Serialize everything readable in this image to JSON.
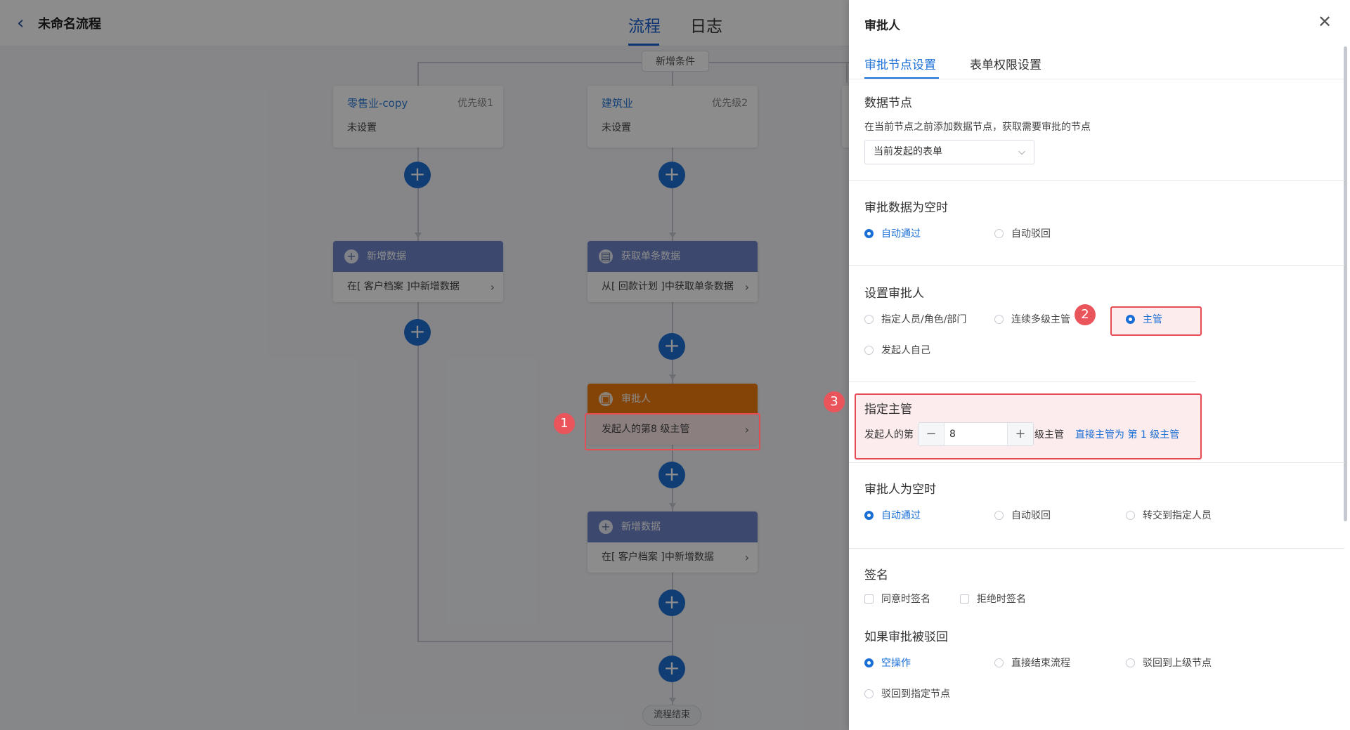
{
  "header": {
    "back_icon": "chevron-left-icon",
    "title": "未命名流程",
    "tabs": [
      "流程",
      "日志"
    ],
    "active_tab": "流程"
  },
  "flow": {
    "add_condition": "新增条件",
    "conditions": [
      {
        "name": "零售业-copy",
        "priority": "优先级1",
        "status": "未设置"
      },
      {
        "name": "建筑业",
        "priority": "优先级2",
        "status": "未设置"
      }
    ],
    "nodes": {
      "left_add": {
        "title": "新增数据",
        "body": "在[ 客户档案 ]中新增数据"
      },
      "mid_fetch": {
        "title": "获取单条数据",
        "body": "从[ 回款计划 ]中获取单条数据"
      },
      "approver": {
        "title": "审批人",
        "body": "发起人的第8 级主管"
      },
      "mid_add": {
        "title": "新增数据",
        "body": "在[ 客户档案 ]中新增数据"
      }
    },
    "end_label": "流程结束",
    "plus_symbol": "+"
  },
  "annotations": [
    "1",
    "2",
    "3"
  ],
  "drawer": {
    "title": "审批人",
    "close_icon": "close-icon",
    "tabs": [
      "审批节点设置",
      "表单权限设置"
    ],
    "active_tab": "审批节点设置",
    "data_node": {
      "title": "数据节点",
      "desc": "在当前节点之前添加数据节点，获取需要审批的节点",
      "select_value": "当前发起的表单"
    },
    "empty_data": {
      "title": "审批数据为空时",
      "options": [
        "自动通过",
        "自动驳回"
      ],
      "selected": "自动通过"
    },
    "set_approver": {
      "title": "设置审批人",
      "options": [
        "指定人员/角色/部门",
        "连续多级主管",
        "主管",
        "发起人自己"
      ],
      "selected": "主管"
    },
    "supervisor": {
      "title": "指定主管",
      "prefix": "发起人的第",
      "minus": "−",
      "value": "8",
      "plus": "+",
      "suffix": "级主管",
      "hint": "直接主管为 第 1 级主管"
    },
    "empty_approver": {
      "title": "审批人为空时",
      "options": [
        "自动通过",
        "自动驳回",
        "转交到指定人员"
      ],
      "selected": "自动通过"
    },
    "signature": {
      "title": "签名",
      "options": [
        "同意时签名",
        "拒绝时签名"
      ]
    },
    "rejected": {
      "title": "如果审批被驳回",
      "options": [
        "空操作",
        "直接结束流程",
        "驳回到上级节点",
        "驳回到指定节点"
      ],
      "selected": "空操作"
    }
  },
  "colors": {
    "accent": "#1a6fd6",
    "node_blue": "#6e84c7",
    "node_orange": "#f07c0e",
    "annotation_red": "#e54d55"
  }
}
